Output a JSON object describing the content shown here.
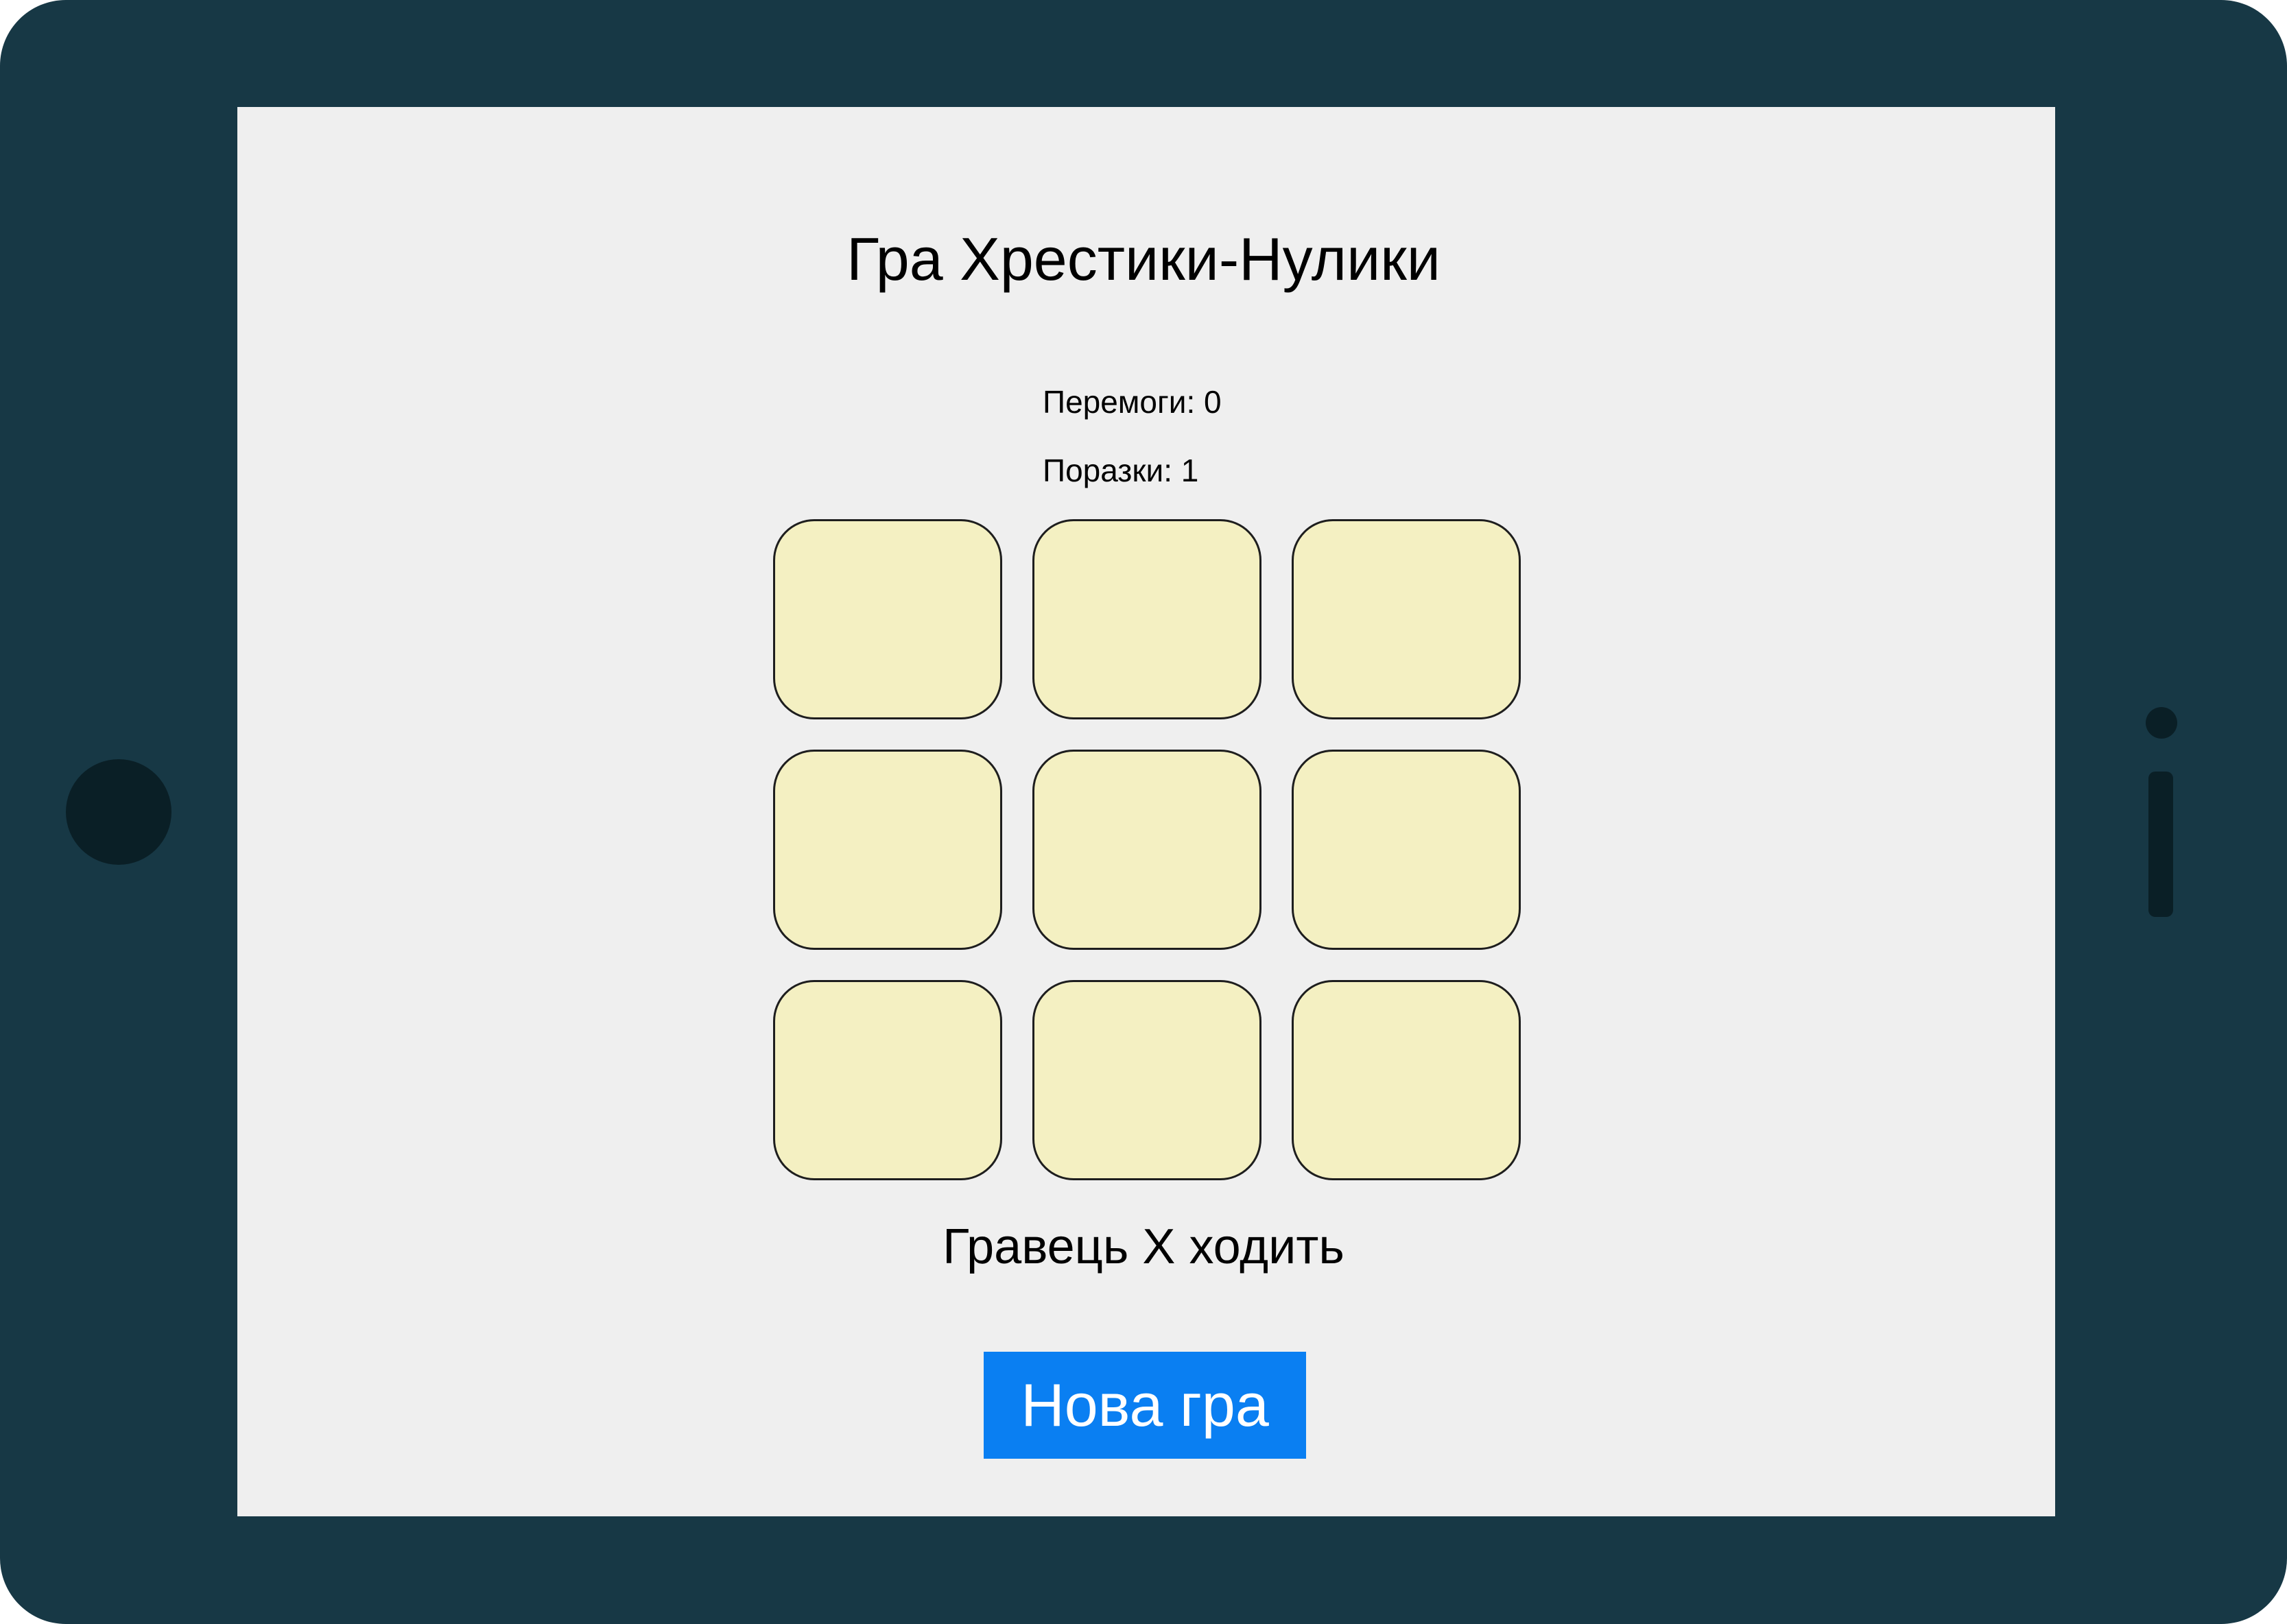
{
  "device": {
    "frame_color": "#173845",
    "screen_color": "#efefef"
  },
  "game": {
    "title": "Гра Хрестики-Нулики",
    "wins_text": "Перемоги: 0",
    "losses_text": "Поразки: 1",
    "status_text": "Гравець X ходить",
    "new_game_label": "Нова гра",
    "accent_color": "#0a7ff2",
    "cell_color": "#f4f0c2",
    "board": [
      "",
      "",
      "",
      "",
      "",
      "",
      "",
      "",
      ""
    ]
  }
}
